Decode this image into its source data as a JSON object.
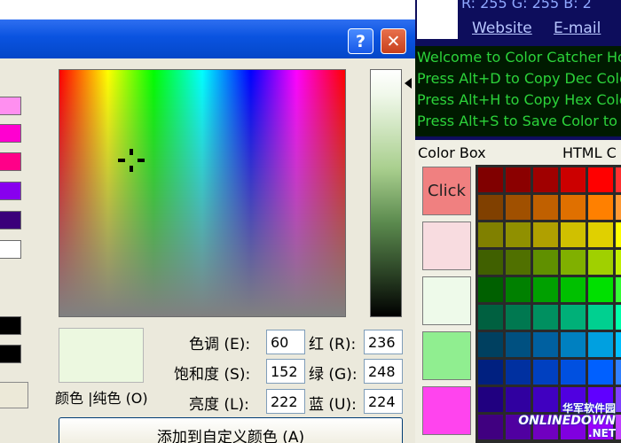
{
  "dialog": {
    "help_label": "?",
    "close_label": "✕",
    "palette_swatches": [
      {
        "color": "#ff8ff0"
      },
      {
        "color": "#ff00d0"
      },
      {
        "color": "#ff0088"
      },
      {
        "color": "#8800ee"
      },
      {
        "color": "#3a007a"
      },
      {
        "color": "#ffffff"
      }
    ],
    "custom_swatches": [
      {
        "color": "#000000"
      },
      {
        "color": "#000000"
      }
    ],
    "preview_color": "#ecf8e0",
    "preview_label": "颜色 |纯色 (O)",
    "fields": {
      "hue": {
        "label": "色调 (E):",
        "value": "60"
      },
      "sat": {
        "label": "饱和度 (S):",
        "value": "152"
      },
      "lum": {
        "label": "亮度 (L):",
        "value": "222"
      },
      "red": {
        "label": "红 (R):",
        "value": "236"
      },
      "green": {
        "label": "绿 (G):",
        "value": "248"
      },
      "blue": {
        "label": "蓝 (U):",
        "value": "224"
      }
    },
    "add_button_label": "添加到自定义颜色 (A)"
  },
  "catcher": {
    "rgb_readout": "R: 255  G: 255  B: 2",
    "website_link": "Website",
    "email_link": "E-mail",
    "console_lines": [
      "Welcome to Color Catcher Hot",
      "Press Alt+D to Copy Dec Colo",
      "Press Alt+H to Copy Hex Colo",
      "Press Alt+S to Save Color to C"
    ],
    "color_box_label": "Color Box",
    "html_label": "HTML C",
    "boxes": [
      {
        "color": "#f08080",
        "label": "Click"
      },
      {
        "color": "#f8dce0",
        "label": ""
      },
      {
        "color": "#eefaea",
        "label": ""
      },
      {
        "color": "#90ee90",
        "label": ""
      },
      {
        "color": "#ff44ee",
        "label": ""
      }
    ],
    "html_colors": [
      [
        "#800000",
        "#8b0000",
        "#a00000",
        "#cc0000",
        "#ff0000",
        "#ff3030"
      ],
      [
        "#804000",
        "#a05000",
        "#c06000",
        "#e07000",
        "#ff8000",
        "#ff9933"
      ],
      [
        "#808000",
        "#909000",
        "#b0a000",
        "#d0c000",
        "#e0d000",
        "#ffff00"
      ],
      [
        "#406000",
        "#507000",
        "#609000",
        "#80b000",
        "#a0d000",
        "#c0f000"
      ],
      [
        "#006000",
        "#008000",
        "#00a000",
        "#00c000",
        "#00e000",
        "#33ff33"
      ],
      [
        "#006040",
        "#007850",
        "#009060",
        "#00b078",
        "#00d090",
        "#00ffaa"
      ],
      [
        "#004060",
        "#005080",
        "#0060a0",
        "#0080c0",
        "#00a0e0",
        "#00c0ff"
      ],
      [
        "#002080",
        "#0030a0",
        "#0040c0",
        "#0050e0",
        "#0060ff",
        "#3080ff"
      ],
      [
        "#200080",
        "#3000a0",
        "#4000c0",
        "#5000e0",
        "#6000ff",
        "#8040ff"
      ],
      [
        "#400080",
        "#5000a0",
        "#7000c0",
        "#8000e0",
        "#a000ff",
        "#c040ff"
      ]
    ]
  },
  "watermark": {
    "line1": "华军软件园",
    "line2": "ONLINEDOWN",
    "line3": ".NET"
  }
}
